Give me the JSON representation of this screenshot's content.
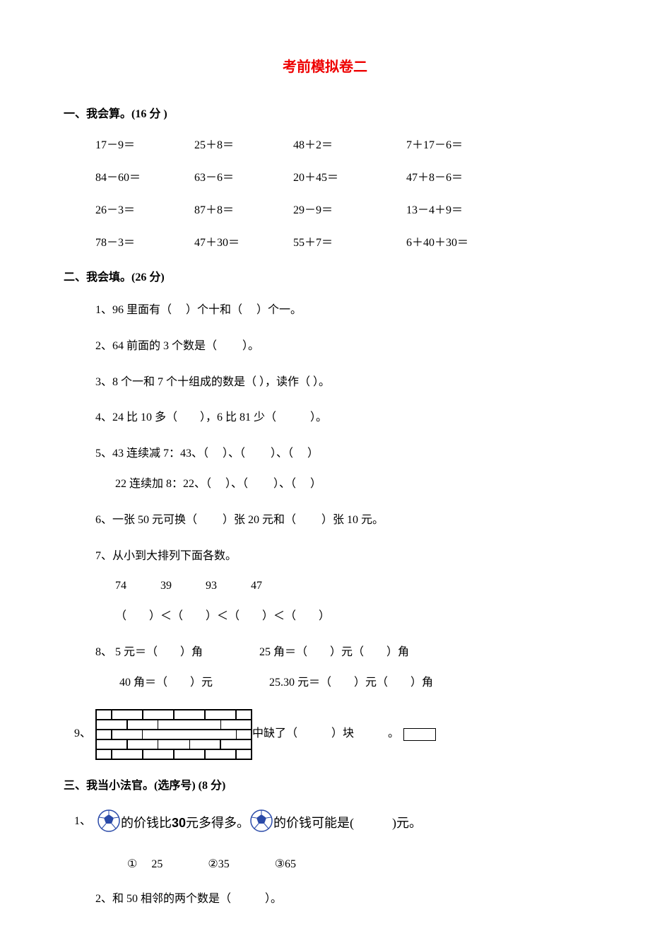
{
  "title": "考前模拟卷二",
  "section1": {
    "heading": "一、我会算。(16 分 )",
    "rows": [
      [
        "17－9＝",
        "25＋8＝",
        "48＋2＝",
        "7＋17－6＝"
      ],
      [
        "84－60＝",
        "63－6＝",
        "20＋45＝",
        "47＋8－6＝"
      ],
      [
        "26－3＝",
        "87＋8＝",
        "29－9＝",
        "13－4＋9＝"
      ],
      [
        "78－3＝",
        "47＋30＝",
        "55＋7＝",
        "6＋40＋30＝"
      ]
    ]
  },
  "section2": {
    "heading": "二、我会填。(26 分)",
    "q1": "1、96 里面有（　  ）个十和（　   ）个一。",
    "q2": "2、64 前面的 3 个数是（　　 ）。",
    "q3": "3、8 个一和 7 个十组成的数是（      ），读作（          ）。",
    "q4": "4、24 比 10 多（　　），6 比 81 少（　　　）。",
    "q5a": "5、43 连续减 7：43、（　   ）、（　　 ）、（　   ）",
    "q5b": "22 连续加 8：22、（　   ）、（　　 ）、（　   ）",
    "q6": "6、一张 50 元可换（　　 ）张 20 元和（　　 ）张 10 元。",
    "q7a": "7、从小到大排列下面各数。",
    "q7b": "74　　　39　　　93　　　47",
    "q7c": "（　　）＜（　　）＜（　　）＜（　　）",
    "q8a": "8、 5 元＝（　　）角　　　　　25 角＝（　　）元（　　）角",
    "q8b": "40 角＝（　　）元　　　　　25.30 元＝（　　）元（　　）角",
    "q9_num": "9、",
    "q9_tail": "中缺了（　　　）块　　　。"
  },
  "section3": {
    "heading": "三、我当小法官。(选序号) (8 分)",
    "q1_num": "1、",
    "q1_mid": "的价钱比",
    "q1_amount": "30",
    "q1_after": "元多得多。",
    "q1_tail": "的价钱可能是(　　　)元。",
    "choices": {
      "c1": "①　 25",
      "c2": "②35",
      "c3": "③65"
    },
    "q2": "2、和 50 相邻的两个数是（　　　）。"
  }
}
